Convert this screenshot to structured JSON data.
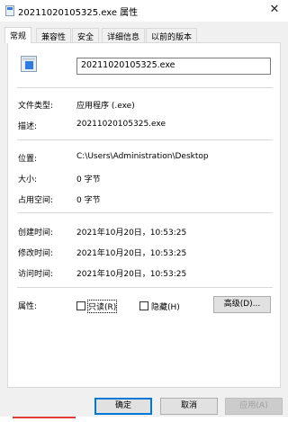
{
  "window": {
    "title": "20211020105325.exe 属性",
    "close_glyph": "✕"
  },
  "tabs": [
    {
      "label": "常规",
      "active": true
    },
    {
      "label": "兼容性",
      "active": false
    },
    {
      "label": "安全",
      "active": false
    },
    {
      "label": "详细信息",
      "active": false
    },
    {
      "label": "以前的版本",
      "active": false
    }
  ],
  "file": {
    "name": "20211020105325.exe",
    "icon": "exe-file-icon"
  },
  "fields": {
    "type_label": "文件类型:",
    "type_value": "应用程序 (.exe)",
    "desc_label": "描述:",
    "desc_value": "20211020105325.exe",
    "location_label": "位置:",
    "location_value": "C:\\Users\\Administration\\Desktop",
    "size_label": "大小:",
    "size_value": "0 字节",
    "disk_label": "占用空间:",
    "disk_value": "0 字节",
    "created_label": "创建时间:",
    "created_value": "2021年10月20日，10:53:25",
    "modified_label": "修改时间:",
    "modified_value": "2021年10月20日，10:53:25",
    "accessed_label": "访问时间:",
    "accessed_value": "2021年10月20日，10:53:25"
  },
  "attributes": {
    "label": "属性:",
    "readonly_label": "只读(R)",
    "readonly_checked": false,
    "hidden_label": "隐藏(H)",
    "hidden_checked": false,
    "advanced_label": "高级(D)..."
  },
  "buttons": {
    "ok": "确定",
    "cancel": "取消",
    "apply": "应用(A)"
  }
}
